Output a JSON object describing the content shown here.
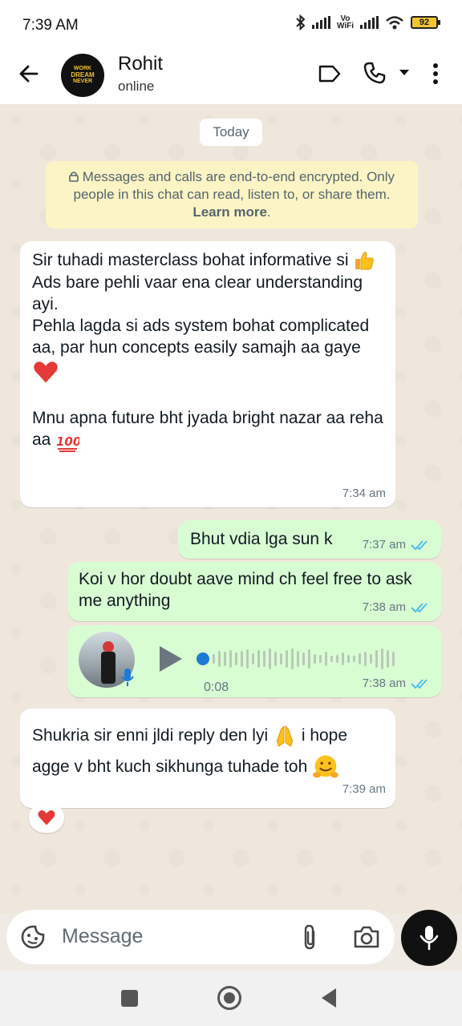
{
  "status_bar": {
    "time": "7:39 AM",
    "vowifi_line1": "Vo",
    "vowifi_line2": "WiFi",
    "battery": "92"
  },
  "header": {
    "contact_name": "Rohit",
    "contact_status": "online",
    "avatar_text": [
      "WORK",
      "DREAM",
      "NEVER"
    ]
  },
  "chat": {
    "date_chip": "Today",
    "encryption_notice": {
      "text": "Messages and calls are end-to-end encrypted. Only people in this chat can read, listen to, or share them.",
      "link": "Learn more",
      "suffix": "."
    },
    "messages": [
      {
        "direction": "incoming",
        "lines": [
          "Sir tuhadi masterclass bohat informative si",
          "Ads bare pehli vaar ena clear understanding ayi.",
          "Pehla lagda si ads system bohat complicated aa, par hun concepts easily samajh aa gaye",
          "Mnu apna future bht jyada bright nazar aa reha aa"
        ],
        "emojis": [
          "thumbs-up",
          "red-heart",
          "hundred-points"
        ],
        "time": "7:34 am"
      },
      {
        "direction": "outgoing",
        "text": "Bhut vdia lga sun k",
        "time": "7:37 am",
        "read": true
      },
      {
        "direction": "outgoing",
        "text": "Koi v hor doubt aave mind ch feel free to ask me anything",
        "time": "7:38 am",
        "read": true
      },
      {
        "direction": "outgoing",
        "type": "voice",
        "duration": "0:08",
        "time": "7:38 am",
        "read": true,
        "progress": 0.0
      },
      {
        "direction": "incoming",
        "text_part1": "Shukria sir enni jldi reply den lyi",
        "text_part2": "i hope",
        "text_part3": "agge v bht kuch sikhunga tuhade toh",
        "emojis": [
          "folded-hands",
          "hugging-face"
        ],
        "time": "7:39 am",
        "reaction": "red-heart"
      }
    ]
  },
  "composer": {
    "placeholder": "Message"
  },
  "colors": {
    "incoming_bubble": "#ffffff",
    "outgoing_bubble": "#d9fdd3",
    "read_ticks": "#53bdeb",
    "chat_bg": "#efe7dc",
    "notice_bg": "#fdf4c5",
    "mic_button": "#111111"
  }
}
